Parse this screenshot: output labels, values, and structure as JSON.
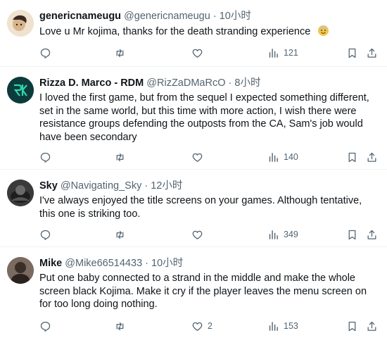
{
  "tweets": [
    {
      "name": "genericnameugu",
      "handle": "@genericnameugu",
      "sep": "·",
      "time": "10小时",
      "text": "Love u Mr kojima, thanks for the  death stranding experience",
      "emoji": "face-icon",
      "replies": "",
      "retweets": "",
      "likes": "",
      "views": "121",
      "avatar_color": "#e8d4b8"
    },
    {
      "name": "Rizza D. Marco - RDM",
      "handle": "@RizZaDMaRcO",
      "sep": "·",
      "time": "8小时",
      "text": "I loved the first game, but from the sequel I expected something different, set in the same world, but this time with more action, I wish there were resistance groups defending the outposts from the CA, Sam's job would have been secondary",
      "replies": "",
      "retweets": "",
      "likes": "",
      "views": "140",
      "avatar_color": "#0b3a3a"
    },
    {
      "name": "Sky",
      "handle": "@Navigating_Sky",
      "sep": "·",
      "time": "12小时",
      "text": "I've always enjoyed the title screens on your games. Although tentative, this one is striking too.",
      "replies": "",
      "retweets": "",
      "likes": "",
      "views": "349",
      "avatar_color": "#2a2a2a"
    },
    {
      "name": "Mike",
      "handle": "@Mike66514433",
      "sep": "·",
      "time": "10小时",
      "text": "Put one baby connected to a strand in the middle and make the whole screen black Kojima. Make it cry if the player leaves the menu screen on for too long doing nothing.",
      "replies": "",
      "retweets": "",
      "likes": "2",
      "views": "153",
      "avatar_color": "#5a4a40"
    }
  ]
}
